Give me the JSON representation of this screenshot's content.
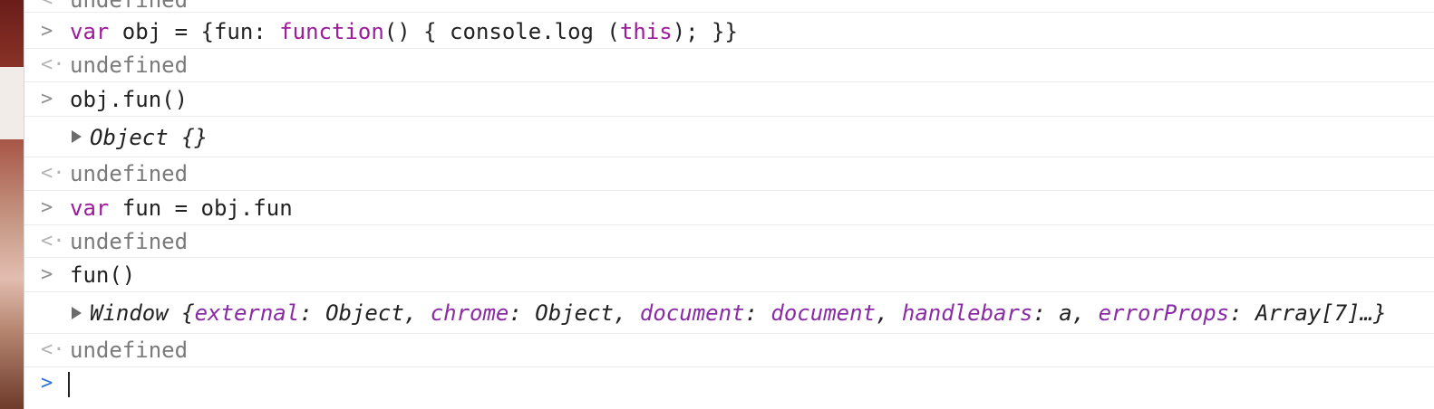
{
  "console": {
    "lines": [
      {
        "type": "result",
        "text": "undefined"
      },
      {
        "type": "input",
        "tokens": [
          {
            "t": "var",
            "kind": "kw"
          },
          {
            "t": " obj = {fun: ",
            "kind": "plain"
          },
          {
            "t": "function",
            "kind": "kw"
          },
          {
            "t": "() { console.log (",
            "kind": "plain"
          },
          {
            "t": "this",
            "kind": "kw"
          },
          {
            "t": "); }}",
            "kind": "plain"
          }
        ]
      },
      {
        "type": "result",
        "text": "undefined"
      },
      {
        "type": "input",
        "text": "obj.fun()"
      },
      {
        "type": "object",
        "text": "Object {}"
      },
      {
        "type": "result",
        "text": "undefined"
      },
      {
        "type": "input",
        "tokens": [
          {
            "t": "var",
            "kind": "kw"
          },
          {
            "t": " fun = obj.fun",
            "kind": "plain"
          }
        ]
      },
      {
        "type": "result",
        "text": "undefined"
      },
      {
        "type": "input",
        "text": "fun()"
      },
      {
        "type": "object_window",
        "tokens": [
          {
            "t": "Window {",
            "kind": "plain"
          },
          {
            "t": "external",
            "kind": "prop"
          },
          {
            "t": ": Object, ",
            "kind": "plain"
          },
          {
            "t": "chrome",
            "kind": "prop"
          },
          {
            "t": ": Object, ",
            "kind": "plain"
          },
          {
            "t": "document",
            "kind": "prop"
          },
          {
            "t": ": ",
            "kind": "plain"
          },
          {
            "t": "document",
            "kind": "prop"
          },
          {
            "t": ", ",
            "kind": "plain"
          },
          {
            "t": "handlebars",
            "kind": "prop"
          },
          {
            "t": ": a, ",
            "kind": "plain"
          },
          {
            "t": "errorProps",
            "kind": "prop"
          },
          {
            "t": ": Array[7]…}",
            "kind": "plain"
          }
        ]
      },
      {
        "type": "result",
        "text": "undefined"
      }
    ]
  },
  "colors": {
    "keyword": "#9c1c9c",
    "property": "#8a2ba5",
    "muted": "#7a7a7a",
    "prompt_active": "#2f6fd6"
  },
  "icons": {
    "prompt": "chevron-right-icon",
    "result": "return-arrow-icon",
    "expand": "disclosure-triangle-icon"
  }
}
